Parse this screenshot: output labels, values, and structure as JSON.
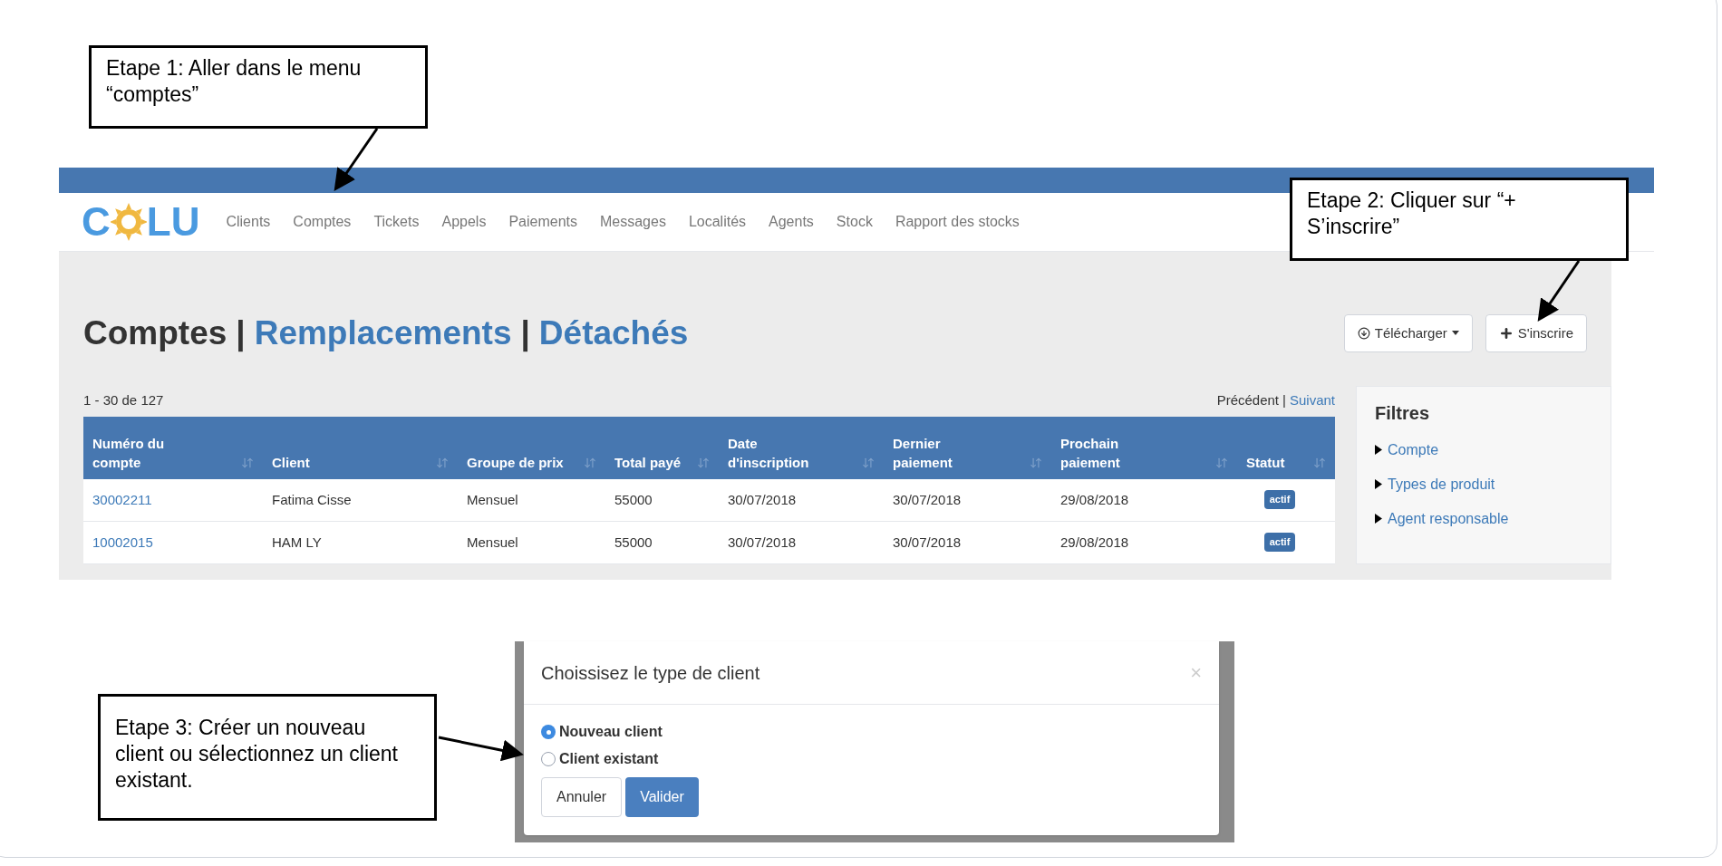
{
  "callouts": [
    {
      "text": "Etape 1: Aller dans le menu “comptes”"
    },
    {
      "text": "Etape 2: Cliquer sur “+ S’inscrire”"
    },
    {
      "text": "Etape 3: Créer un nouveau client ou sélectionnez un client existant."
    }
  ],
  "app": {
    "logo_start": "C",
    "logo_end": "LU",
    "nav": [
      "Clients",
      "Comptes",
      "Tickets",
      "Appels",
      "Paiements",
      "Messages",
      "Localités",
      "Agents",
      "Stock",
      "Rapport des stocks"
    ],
    "separator": "|",
    "heading": [
      {
        "text": "Comptes",
        "selected": true
      },
      {
        "text": "Remplacements",
        "selected": false
      },
      {
        "text": "Détachés",
        "selected": false
      }
    ],
    "buttons": [
      "Télécharger",
      "S'inscrire"
    ],
    "count": "1 - 30 de 127",
    "pager": {
      "previous": "Précédent",
      "next": "Suivant"
    },
    "table": {
      "columns": [
        "Numéro du compte",
        "Client",
        "Groupe de prix",
        "Total payé",
        "Date d'inscription",
        "Dernier paiement",
        "Prochain paiement",
        "Statut"
      ],
      "rows": [
        {
          "cells": [
            "30002211",
            "Fatima Cisse",
            "Mensuel",
            "55000",
            "30/07/2018",
            "30/07/2018",
            "29/08/2018"
          ],
          "status": "actif"
        },
        {
          "cells": [
            "10002015",
            "HAM LY",
            "Mensuel",
            "55000",
            "30/07/2018",
            "30/07/2018",
            "29/08/2018"
          ],
          "status": "actif"
        }
      ]
    },
    "filters": {
      "title": "Filtres",
      "items": [
        "Compte",
        "Types de produit",
        "Agent responsable"
      ]
    }
  },
  "dialog": {
    "title": "Choissisez le type de client",
    "close": "×",
    "options": [
      {
        "label": "Nouveau client",
        "selected": true
      },
      {
        "label": "Client existant",
        "selected": false
      }
    ],
    "buttons": [
      {
        "label": "Annuler",
        "kind": "default"
      },
      {
        "label": "Valider",
        "kind": "primary"
      }
    ]
  }
}
